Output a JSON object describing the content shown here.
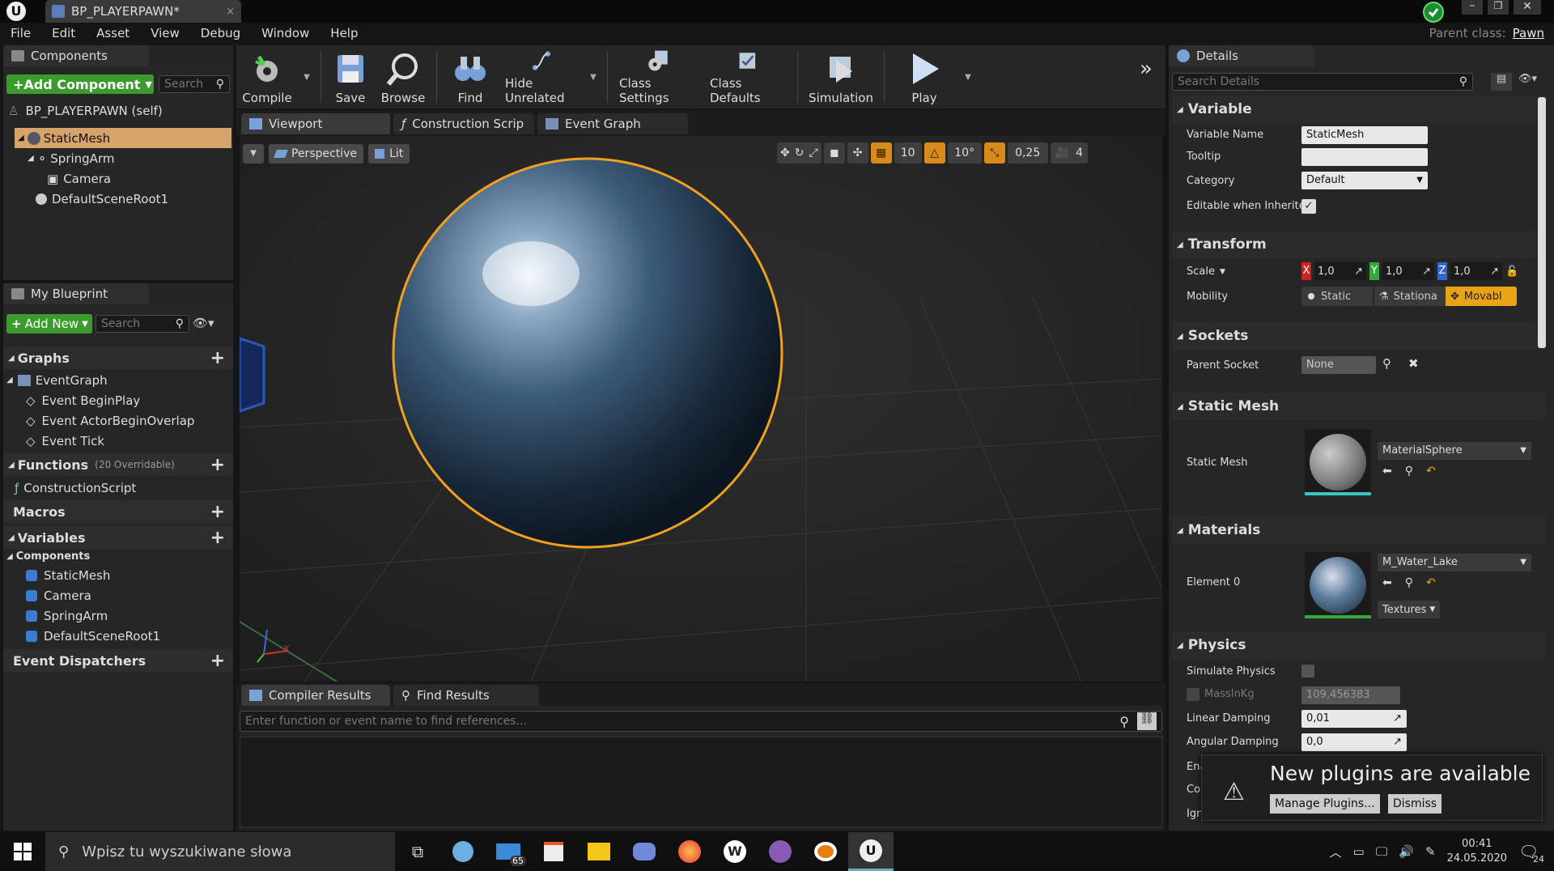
{
  "window": {
    "tab_title": "BP_PLAYERPAWN*",
    "parent_class_label": "Parent class:",
    "parent_class_value": "Pawn"
  },
  "menu": [
    "File",
    "Edit",
    "Asset",
    "View",
    "Debug",
    "Window",
    "Help"
  ],
  "components_panel": {
    "tab": "Components",
    "add_button": "+Add Component",
    "search_placeholder": "Search",
    "self_label": "BP_PLAYERPAWN (self)",
    "tree": [
      "StaticMesh",
      "SpringArm",
      "Camera",
      "DefaultSceneRoot1"
    ]
  },
  "blueprint_panel": {
    "tab": "My Blueprint",
    "add_new": "Add New",
    "search_placeholder": "Search",
    "graphs_label": "Graphs",
    "event_graph": "EventGraph",
    "events": [
      "Event BeginPlay",
      "Event ActorBeginOverlap",
      "Event Tick"
    ],
    "functions_label": "Functions",
    "functions_overridable": "(20 Overridable)",
    "construction_script": "ConstructionScript",
    "macros_label": "Macros",
    "variables_label": "Variables",
    "components_label": "Components",
    "component_vars": [
      "StaticMesh",
      "Camera",
      "SpringArm",
      "DefaultSceneRoot1"
    ],
    "dispatchers_label": "Event Dispatchers"
  },
  "toolbar": {
    "compile": "Compile",
    "save": "Save",
    "browse": "Browse",
    "find": "Find",
    "hide_unrelated": "Hide Unrelated",
    "class_settings": "Class Settings",
    "class_defaults": "Class Defaults",
    "simulation": "Simulation",
    "play": "Play"
  },
  "editor_tabs": [
    "Viewport",
    "Construction Scrip",
    "Event Graph"
  ],
  "viewport": {
    "perspective": "Perspective",
    "lit": "Lit",
    "grid_snap": "10",
    "rot_snap": "10°",
    "scale_snap": "0,25",
    "camera_speed": "4",
    "axis_x": "X"
  },
  "bottom_panel": {
    "tabs": [
      "Compiler Results",
      "Find Results"
    ],
    "find_placeholder": "Enter function or event name to find references..."
  },
  "details": {
    "tab": "Details",
    "search_placeholder": "Search Details",
    "variable_section": "Variable",
    "variable_name_label": "Variable Name",
    "variable_name_value": "StaticMesh",
    "tooltip_label": "Tooltip",
    "tooltip_value": "",
    "category_label": "Category",
    "category_value": "Default",
    "editable_label": "Editable when Inherited",
    "transform_section": "Transform",
    "scale_label": "Scale",
    "scale_x": "1,0",
    "scale_y": "1,0",
    "scale_z": "1,0",
    "axis_x": "X",
    "axis_y": "Y",
    "axis_z": "Z",
    "mobility_label": "Mobility",
    "mobility_static": "Static",
    "mobility_stationary": "Stationa",
    "mobility_movable": "Movabl",
    "sockets_section": "Sockets",
    "parent_socket_label": "Parent Socket",
    "parent_socket_value": "None",
    "static_mesh_section": "Static Mesh",
    "static_mesh_label": "Static Mesh",
    "static_mesh_value": "MaterialSphere",
    "materials_section": "Materials",
    "element0_label": "Element 0",
    "element0_value": "M_Water_Lake",
    "textures_button": "Textures",
    "physics_section": "Physics",
    "simulate_physics_label": "Simulate Physics",
    "mass_label": "MassInKg",
    "mass_value": "109,456383",
    "linear_damping_label": "Linear Damping",
    "linear_damping_value": "0,01",
    "angular_damping_label": "Angular Damping",
    "angular_damping_value": "0,0",
    "trunc1": "Ena",
    "trunc2": "Cor",
    "trunc3": "Ign"
  },
  "notification": {
    "title": "New plugins are available",
    "manage": "Manage Plugins...",
    "dismiss": "Dismiss"
  },
  "taskbar": {
    "search_placeholder": "Wpisz tu wyszukiwane słowa",
    "mail_badge": "65",
    "time": "00:41",
    "date": "24.05.2020",
    "notif_count": "24"
  },
  "colors": {
    "accent_orange": "#e8a317",
    "selection": "#d6a46a",
    "green_button": "#4caf3a",
    "sphere_outline": "#f0a020"
  }
}
